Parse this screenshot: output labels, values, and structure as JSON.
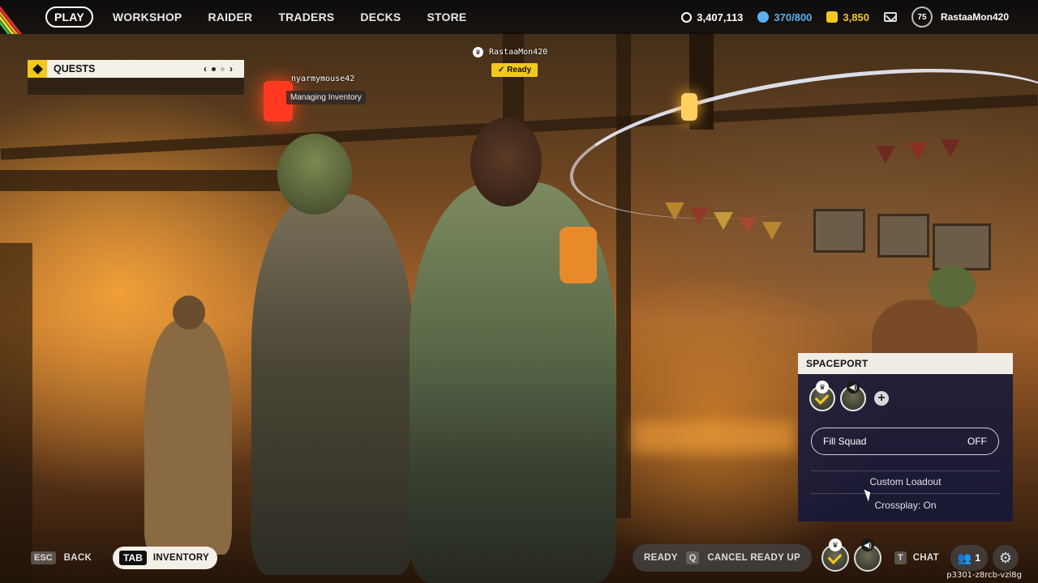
{
  "nav": {
    "items": [
      {
        "label": "PLAY",
        "active": true
      },
      {
        "label": "WORKSHOP"
      },
      {
        "label": "RAIDER"
      },
      {
        "label": "TRADERS"
      },
      {
        "label": "DECKS"
      },
      {
        "label": "STORE"
      }
    ]
  },
  "currencies": {
    "coins": "3,407,113",
    "credits": "370/800",
    "tokens": "3,850",
    "credits_color": "#5ab0f0",
    "tokens_color": "#f2c81e"
  },
  "profile": {
    "level": "75",
    "username": "RastaaMon420"
  },
  "quests": {
    "title": "QUESTS",
    "prev": "‹",
    "next": "›"
  },
  "players": {
    "left": {
      "name": "nyarmymouse42",
      "status": "Managing Inventory"
    },
    "right": {
      "name": "RastaaMon420",
      "status": "Ready"
    }
  },
  "spaceport": {
    "title": "SPACEPORT",
    "add": "+",
    "fill_squad_label": "Fill Squad",
    "fill_squad_value": "OFF",
    "custom_loadout": "Custom Loadout",
    "crossplay": "Crossplay: On"
  },
  "bottom": {
    "back_key": "ESC",
    "back_label": "BACK",
    "inventory_key": "TAB",
    "inventory_label": "INVENTORY",
    "ready_label": "READY",
    "cancel_key": "Q",
    "cancel_label": "CANCEL READY UP",
    "chat_key": "T",
    "chat_label": "CHAT",
    "friends_count": "1",
    "session_id": "p3301-z8rcb-vzl8g"
  }
}
